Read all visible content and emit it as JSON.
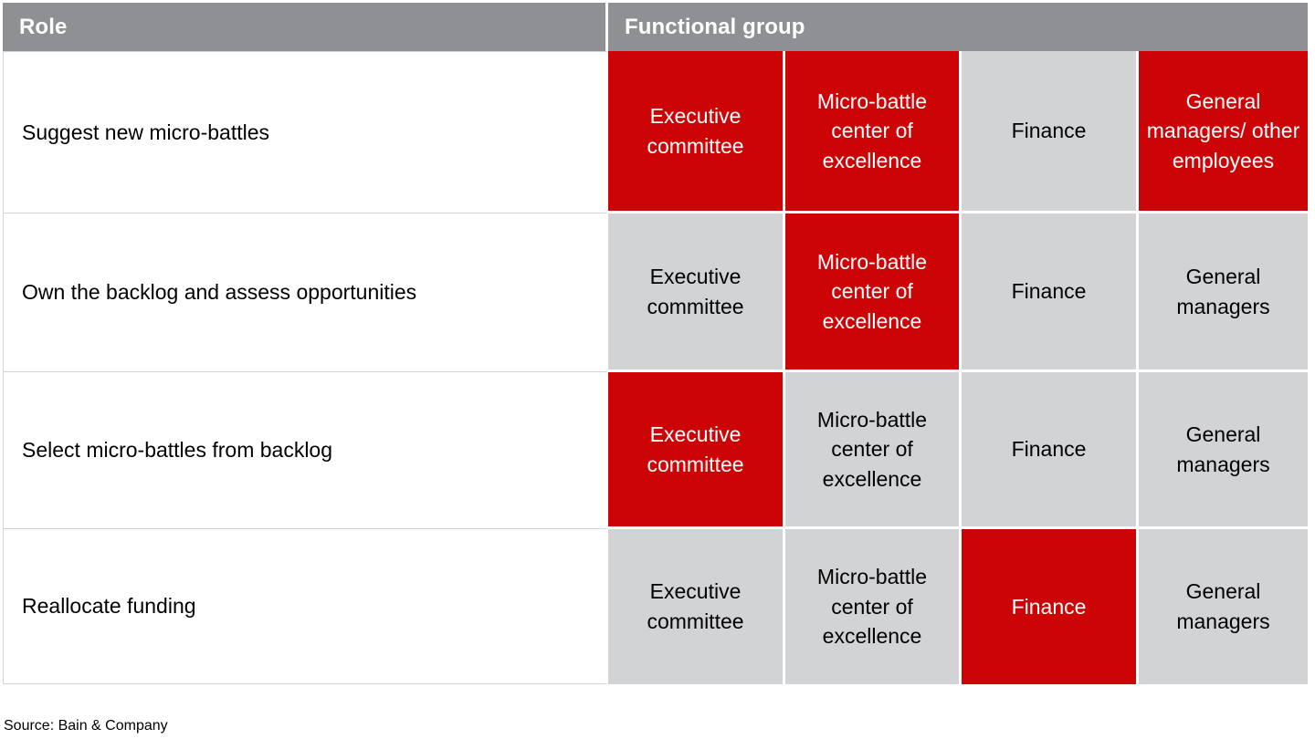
{
  "colors": {
    "header_grey": "#8e9094",
    "cell_grey": "#d2d3d5",
    "accent_red": "#cc0406",
    "white": "#ffffff",
    "text_black": "#000000"
  },
  "table": {
    "headers": {
      "role": "Role",
      "functional_group": "Functional group"
    },
    "functional_groups": [
      "Executive committee",
      "Micro-battle center of excellence",
      "Finance",
      "General managers"
    ],
    "rows": [
      {
        "role": "Suggest new micro-battles",
        "cells": [
          {
            "label": "Executive committee",
            "state": "red"
          },
          {
            "label": "Micro-battle center of excellence",
            "state": "red"
          },
          {
            "label": "Finance",
            "state": "grey"
          },
          {
            "label": "General managers/ other employees",
            "state": "red"
          }
        ]
      },
      {
        "role": "Own the backlog and assess opportunities",
        "cells": [
          {
            "label": "Executive committee",
            "state": "grey"
          },
          {
            "label": "Micro-battle center of excellence",
            "state": "red"
          },
          {
            "label": "Finance",
            "state": "grey"
          },
          {
            "label": "General managers",
            "state": "grey"
          }
        ]
      },
      {
        "role": "Select micro-battles from backlog",
        "cells": [
          {
            "label": "Executive committee",
            "state": "red"
          },
          {
            "label": "Micro-battle center of excellence",
            "state": "grey"
          },
          {
            "label": "Finance",
            "state": "grey"
          },
          {
            "label": "General managers",
            "state": "grey"
          }
        ]
      },
      {
        "role": "Reallocate funding",
        "cells": [
          {
            "label": "Executive committee",
            "state": "grey"
          },
          {
            "label": "Micro-battle center of excellence",
            "state": "grey"
          },
          {
            "label": "Finance",
            "state": "red"
          },
          {
            "label": "General managers",
            "state": "grey"
          }
        ]
      }
    ]
  },
  "footer": {
    "source": "Source: Bain & Company"
  }
}
